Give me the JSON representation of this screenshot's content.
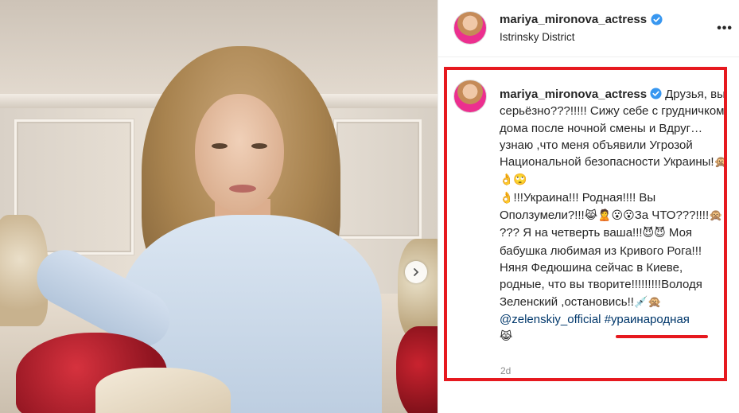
{
  "post": {
    "username": "mariya_mironova_actress",
    "location": "Istrinsky District",
    "more_label": "•••",
    "icons": {
      "verified": "verified-badge-icon",
      "more": "more-options-icon",
      "carousel_next": "chevron-right-icon"
    }
  },
  "caption": {
    "username": "mariya_mironova_actress",
    "text_1": "Друзья, вы серьёзно???!!!!! Сижу себе с грудничком дома после ночной смены и Вдруг… узнаю ,что меня объявили Угрозой Национальной безопасности Украины!",
    "emoji_1": "🙊👌🙄",
    "emoji_2": "👌",
    "text_2": "!!!Украина!!! Родная!!!! Вы Оползумели?!!!",
    "emoji_3": "😹🙎😮😮",
    "text_3": "За ЧТО???!!!!",
    "emoji_4": "🙊",
    "text_4": " ??? Я на четверть ваша!!!",
    "emoji_5": "😈😈",
    "text_5": " Моя бабушка любимая из Кривого Рога!!! Няня Федюшина сейчас в Киеве, родные, что вы творите!!!!!!!!!Володя Зеленский ,остановись!!",
    "emoji_6": "💉🙊",
    "mention": "@zelenskiy_official",
    "hashtag": "#ураинародная",
    "emoji_7": "😹"
  },
  "timestamp": "2d",
  "colors": {
    "annotation": "#e6191f",
    "link": "#00376b",
    "verified": "#3897f0",
    "muted": "#8e8e8e"
  }
}
